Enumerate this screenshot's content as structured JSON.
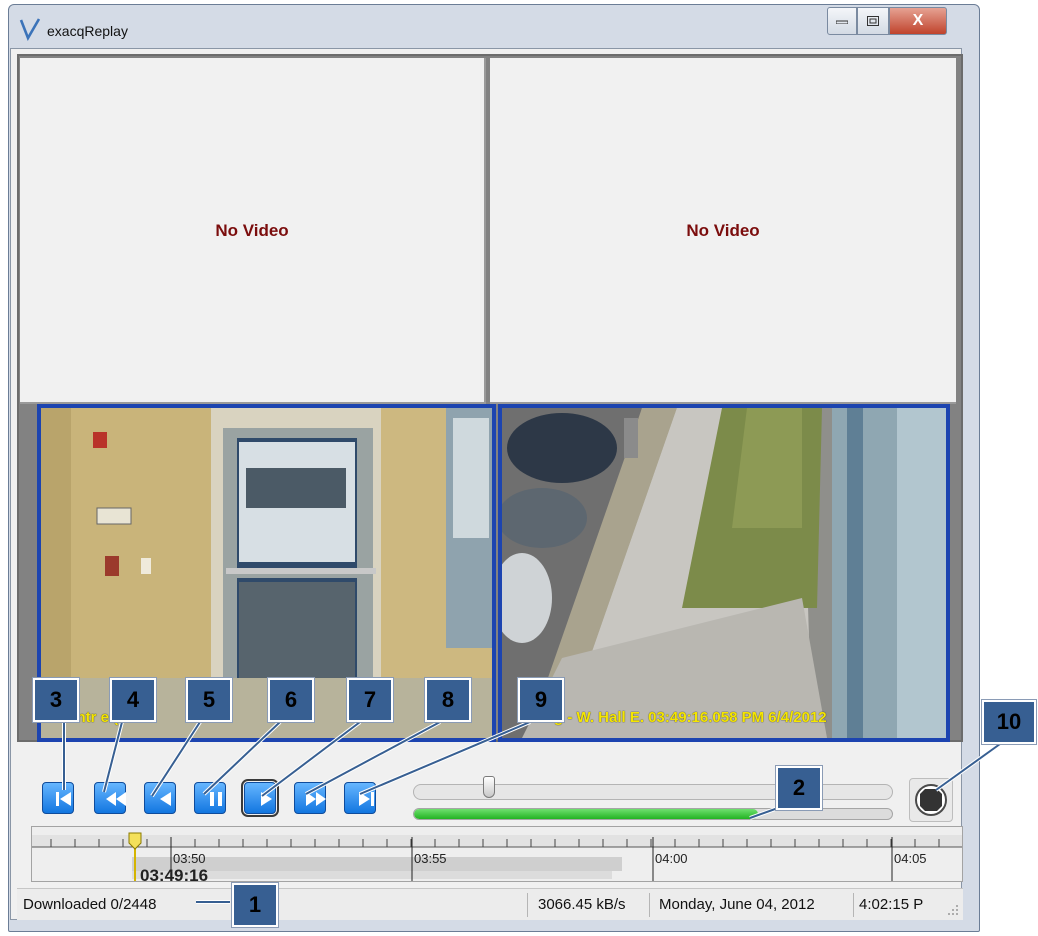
{
  "window": {
    "title": "exacqReplay",
    "close_glyph": "X"
  },
  "panes": [
    {
      "message": "No Video"
    },
    {
      "message": "No Video"
    }
  ],
  "cameras": [
    {
      "overlay": "lo   ntr   e (   5.0"
    },
    {
      "overlay": "g - W. Hall E. 03:49:16.058 PM 6/4/2012"
    }
  ],
  "controls": {
    "buttons": [
      {
        "name": "skip-to-start",
        "icon": "skip-to-start-icon"
      },
      {
        "name": "rewind",
        "icon": "rewind-icon"
      },
      {
        "name": "step-back",
        "icon": "step-back-icon"
      },
      {
        "name": "pause",
        "icon": "pause-icon"
      },
      {
        "name": "play",
        "icon": "play-icon",
        "active": true
      },
      {
        "name": "fast-forward",
        "icon": "fast-forward-icon"
      },
      {
        "name": "skip-to-end",
        "icon": "skip-to-end-icon"
      }
    ],
    "speed_slider_level": 0.15,
    "download_progress": 0.72
  },
  "timeline": {
    "ticks": [
      "03:50",
      "03:55",
      "04:00",
      "04:05"
    ],
    "current_time": "03:49:16"
  },
  "status_bar": {
    "downloaded": "Downloaded 0/2448",
    "rate": "3066.45 kB/s",
    "date": "Monday, June 04, 2012",
    "time": "4:02:15 P"
  },
  "callouts": [
    "1",
    "2",
    "3",
    "4",
    "5",
    "6",
    "7",
    "8",
    "9",
    "10"
  ],
  "colors": {
    "accent_blue": "#1c44b0",
    "no_video_text": "#7b0d0d",
    "overlay_text": "#f5e600",
    "progress_green": "#22b322",
    "callout_fill": "#375f92"
  }
}
